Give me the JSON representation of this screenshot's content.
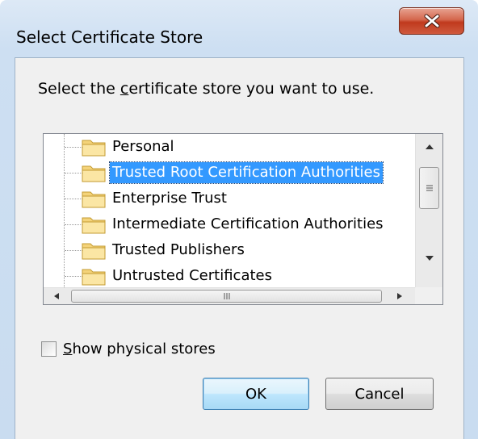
{
  "window": {
    "title": "Select Certificate Store",
    "close_glyph": "X"
  },
  "prompt": {
    "before": "Select the ",
    "mnemonic": "c",
    "after": "ertificate store you want to use."
  },
  "tree": {
    "items": [
      {
        "label": "Personal",
        "selected": false
      },
      {
        "label": "Trusted Root Certification Authorities",
        "selected": true
      },
      {
        "label": "Enterprise Trust",
        "selected": false
      },
      {
        "label": "Intermediate Certification Authorities",
        "selected": false
      },
      {
        "label": "Trusted Publishers",
        "selected": false
      },
      {
        "label": "Untrusted Certificates",
        "selected": false
      }
    ],
    "icon": "folder-icon"
  },
  "checkbox": {
    "mnemonic": "S",
    "label_rest": "how physical stores",
    "checked": false
  },
  "buttons": {
    "ok": "OK",
    "cancel": "Cancel"
  },
  "colors": {
    "selection": "#3399ff",
    "close": "#c0391d"
  }
}
